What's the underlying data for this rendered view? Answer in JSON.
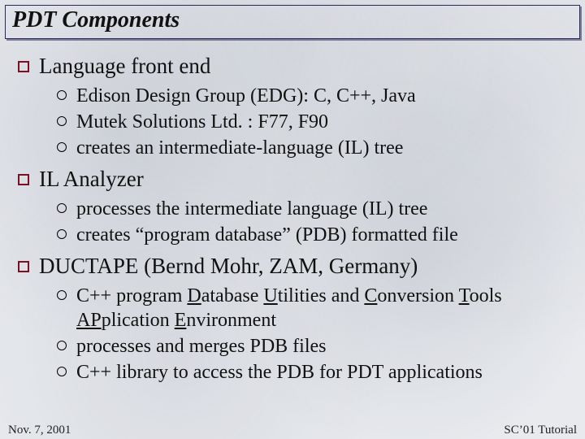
{
  "title": "PDT Components",
  "sections": [
    {
      "heading": "Language front end",
      "items": [
        {
          "text": "Edison Design Group (EDG): C, C++, Java"
        },
        {
          "text": "Mutek Solutions Ltd. : F77, F90"
        },
        {
          "text": "creates an intermediate-language (IL) tree"
        }
      ]
    },
    {
      "heading": "IL Analyzer",
      "items": [
        {
          "text": "processes the intermediate language (IL) tree"
        },
        {
          "text": "creates “program database” (PDB) formatted file"
        }
      ]
    },
    {
      "heading": "DUCTAPE (Bernd Mohr, ZAM, Germany)",
      "items": [
        {
          "html": "C++ program <span class=\"u\">D</span>atabase <span class=\"u\">U</span>tilities and <span class=\"u\">C</span>onversion <span class=\"u\">T</span>ools <span class=\"u\">AP</span>plication <span class=\"u\">E</span>nvironment"
        },
        {
          "text": "processes and merges PDB files"
        },
        {
          "text": "C++ library to access the PDB for PDT applications"
        }
      ]
    }
  ],
  "footer": {
    "left": "Nov. 7, 2001",
    "right": "SC’01 Tutorial"
  }
}
